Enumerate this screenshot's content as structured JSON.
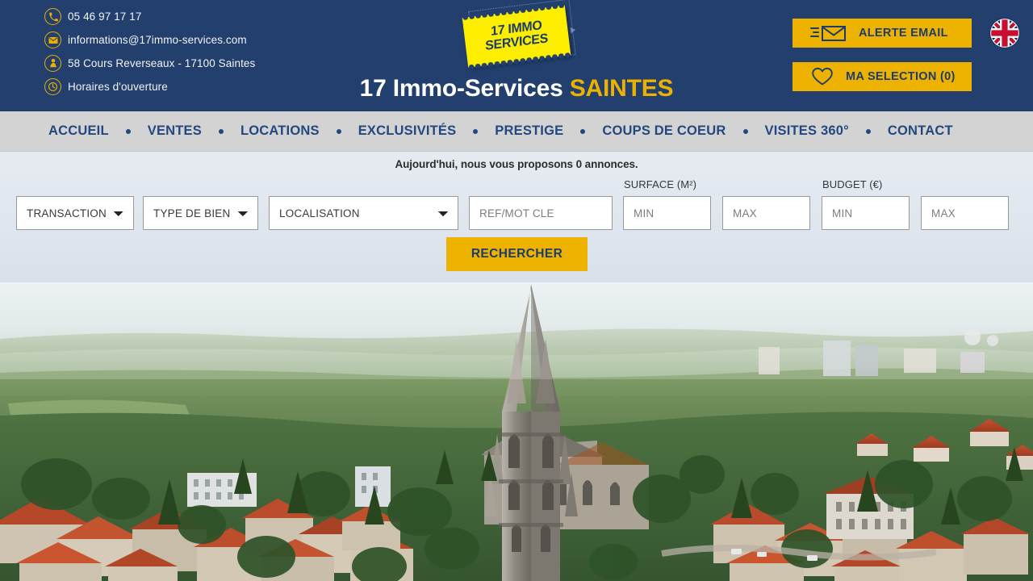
{
  "header": {
    "contacts": [
      {
        "icon": "phone-icon",
        "text": "05 46 97 17 17"
      },
      {
        "icon": "envelope-icon",
        "text": "informations@17immo-services.com"
      },
      {
        "icon": "map-pin-icon",
        "text": "58 Cours Reverseaux - 17100 Saintes"
      },
      {
        "icon": "clock-icon",
        "text": "Horaires d'ouverture"
      }
    ],
    "logo": {
      "line1": "17 IMMO",
      "line2": "SERVICES"
    },
    "title_main": "17 Immo-Services",
    "title_accent": "SAINTES",
    "alert_button": {
      "label": "ALERTE EMAIL",
      "icon": "email-alert-icon"
    },
    "selection_button": {
      "label": "MA SELECTION (0)",
      "icon": "heart-icon"
    },
    "language_flag": "uk-flag-icon",
    "bg_color": "#223f6e",
    "accent_color": "#edb200"
  },
  "nav": {
    "items": [
      "ACCUEIL",
      "VENTES",
      "LOCATIONS",
      "EXCLUSIVITÉS",
      "PRESTIGE",
      "COUPS DE COEUR",
      "VISITES 360°",
      "CONTACT"
    ],
    "bg_color": "#d3d3d3",
    "text_color": "#23477e"
  },
  "search": {
    "announce": "Aujourd'hui, nous vous proposons 0 annonces.",
    "transaction": {
      "value": "TRANSACTION"
    },
    "property_type": {
      "value": "TYPE DE BIEN"
    },
    "location": {
      "value": "LOCALISATION"
    },
    "reference": {
      "placeholder": "REF/MOT CLE",
      "value": ""
    },
    "surface": {
      "label": "SURFACE (M²)",
      "min_placeholder": "MIN",
      "max_placeholder": "MAX"
    },
    "budget": {
      "label": "BUDGET (€)",
      "min_placeholder": "MIN",
      "max_placeholder": "MAX"
    },
    "submit_label": "RECHERCHER"
  },
  "hero": {
    "alt": "Vue aérienne de Saintes avec la basilique Saint-Eutrope"
  }
}
